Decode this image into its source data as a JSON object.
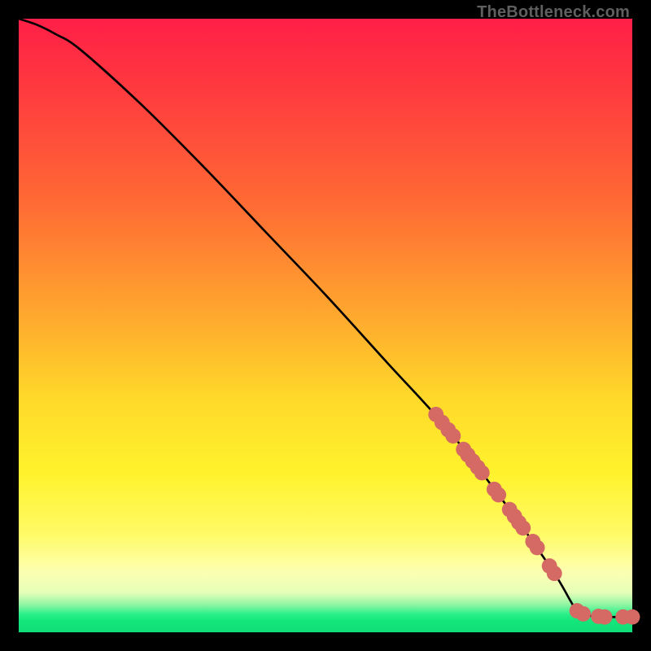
{
  "watermark": "TheBottleneck.com",
  "colors": {
    "dot": "#d46a63",
    "curve": "#000000",
    "frame_bg": "#000000"
  },
  "chart_data": {
    "type": "line",
    "title": "",
    "xlabel": "",
    "ylabel": "",
    "xlim": [
      0,
      100
    ],
    "ylim": [
      0,
      100
    ],
    "grid": false,
    "legend": false,
    "curve": {
      "comment": "Monotone decreasing curve: slight convex shoulder top-left, near-linear diagonal, knee near x≈91 flattening to y≈2.5",
      "x": [
        0,
        3,
        6,
        10,
        20,
        30,
        40,
        50,
        60,
        70,
        80,
        85,
        88,
        90,
        91,
        93,
        96,
        100
      ],
      "y": [
        100,
        99,
        97.5,
        95,
        86,
        76,
        65.5,
        55,
        44,
        33,
        20,
        13,
        8.5,
        5,
        3.5,
        2.7,
        2.5,
        2.5
      ]
    },
    "dots": {
      "comment": "Salmon dots clustered along the lower-right segment of the curve and along the flat tail",
      "points": [
        [
          68,
          35.5
        ],
        [
          69,
          34.2
        ],
        [
          70,
          33
        ],
        [
          70.8,
          32
        ],
        [
          72.5,
          29.8
        ],
        [
          73.2,
          28.9
        ],
        [
          74,
          27.9
        ],
        [
          74.8,
          26.9
        ],
        [
          75.5,
          26
        ],
        [
          77.5,
          23.3
        ],
        [
          78.2,
          22.4
        ],
        [
          80,
          20
        ],
        [
          80.8,
          18.9
        ],
        [
          81.5,
          17.9
        ],
        [
          82.2,
          17
        ],
        [
          83.8,
          14.8
        ],
        [
          84.5,
          13.8
        ],
        [
          86.5,
          10.8
        ],
        [
          87.3,
          9.6
        ],
        [
          91,
          3.5
        ],
        [
          92,
          3
        ],
        [
          94.5,
          2.6
        ],
        [
          95.5,
          2.5
        ],
        [
          98.5,
          2.5
        ],
        [
          100,
          2.5
        ]
      ]
    }
  }
}
